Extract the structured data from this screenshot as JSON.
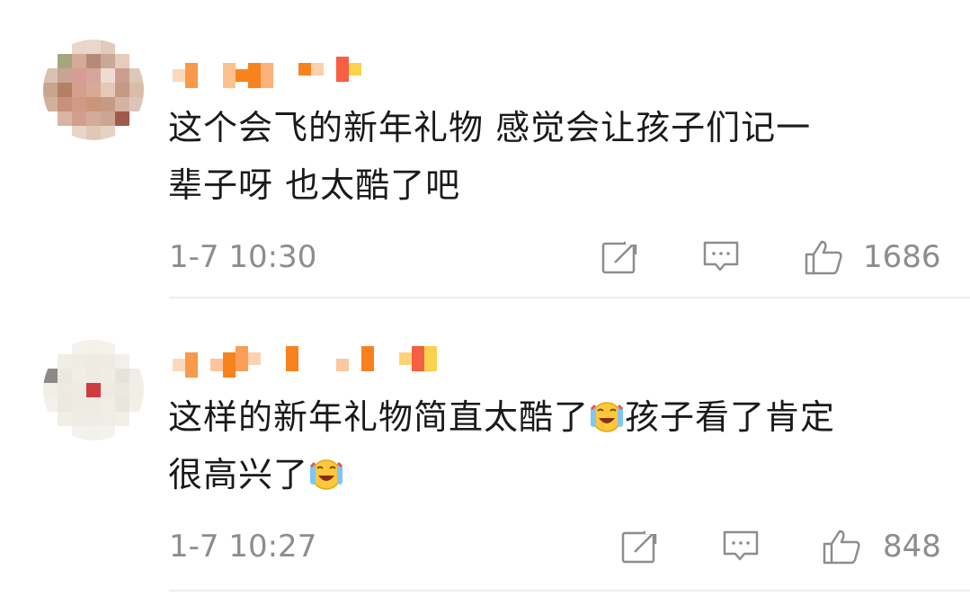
{
  "comments": [
    {
      "text_line1": "这个会飞的新年礼物 感觉会让孩子们记一",
      "text_line2": "辈子呀 也太酷了吧",
      "time": "1-7 10:30",
      "likes": "1686",
      "icons": [
        "repost-icon",
        "comment-icon",
        "like-icon"
      ]
    },
    {
      "text_part1": "这样的新年礼物简直太酷了",
      "text_part2": "孩子看了肯定",
      "text_line2": "很高兴了",
      "emoji": "laugh-cry-emoji",
      "time": "1-7 10:27",
      "likes": "848",
      "icons": [
        "repost-icon",
        "comment-icon",
        "like-icon"
      ]
    }
  ],
  "colors": {
    "text": "#1a1a1a",
    "meta": "#8d8d8d",
    "username_orange": "#f8821e",
    "divider": "#ededed"
  }
}
